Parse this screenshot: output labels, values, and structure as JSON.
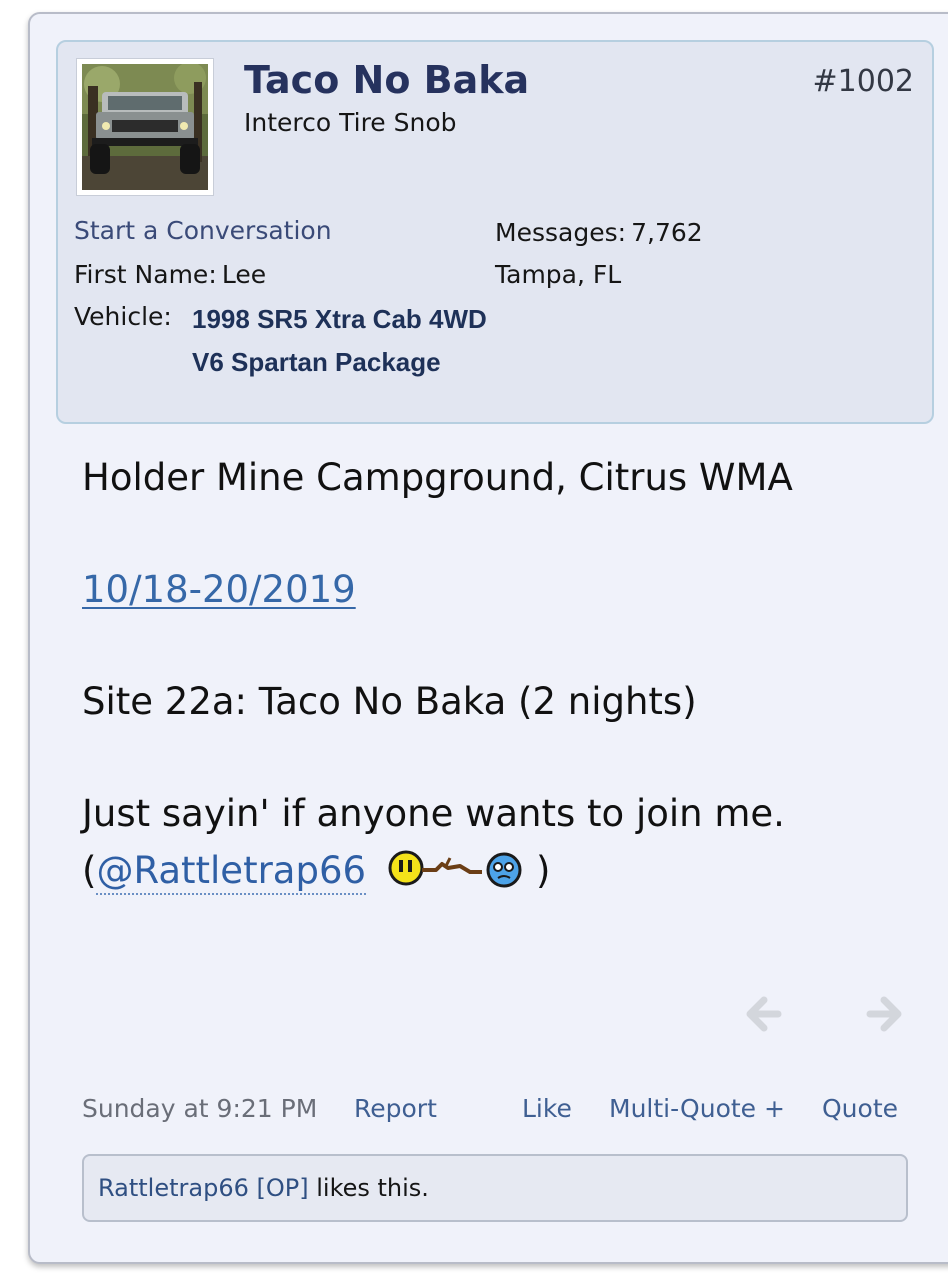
{
  "post": {
    "number": "#1002",
    "user": {
      "name": "Taco No Baka",
      "title": "Interco Tire Snob",
      "start_conversation": "Start a Conversation",
      "first_name_label": "First Name:",
      "first_name": "Lee",
      "vehicle_label": "Vehicle:",
      "vehicle": "1998 SR5 Xtra Cab 4WD V6 Spartan Package",
      "messages_label": "Messages:",
      "messages": "7,762",
      "location": "Tampa, FL"
    },
    "content": {
      "line1": "Holder Mine Campground, Citrus WMA",
      "date_link": "10/18-20/2019",
      "line3": "Site 22a: Taco No Baka (2 nights)",
      "line4": "Just sayin' if anyone wants to join me.",
      "open_paren": "(",
      "mention": "@Rattletrap66",
      "close_paren": ")",
      "smiley": "smiley-stick-poke-icon"
    },
    "footer": {
      "timestamp": "Sunday at 9:21 PM",
      "report": "Report",
      "like": "Like",
      "multi_quote": "Multi-Quote +",
      "quote": "Quote"
    },
    "likes": {
      "user": "Rattletrap66 [OP]",
      "text": "likes this."
    }
  },
  "colors": {
    "background": "#f0f2fa",
    "userbox": "#e2e6f1",
    "username": "#26325e",
    "link": "#3f5f92"
  }
}
